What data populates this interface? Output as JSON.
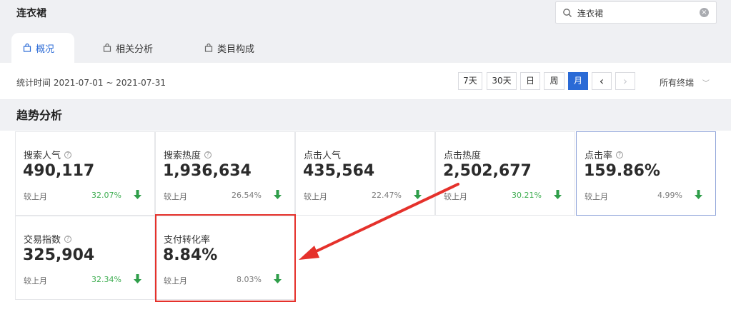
{
  "header": {
    "title": "连衣裙"
  },
  "search": {
    "value": "连衣裙"
  },
  "tabs": [
    {
      "label": "概况",
      "active": true
    },
    {
      "label": "相关分析",
      "active": false
    },
    {
      "label": "类目构成",
      "active": false
    }
  ],
  "filter": {
    "stat_time": "统计时间 2021-07-01 ~ 2021-07-31",
    "periods": [
      "7天",
      "30天",
      "日",
      "周",
      "月"
    ],
    "active_period": "月",
    "prev": "‹",
    "next": "›",
    "terminal": "所有终端"
  },
  "section": {
    "title": "趋势分析"
  },
  "compare_label": "较上月",
  "metrics": [
    {
      "label": "搜索人气",
      "help": true,
      "value": "490,117",
      "change": "32.07%",
      "change_color": "#3fae52",
      "direction": "down"
    },
    {
      "label": "搜索热度",
      "help": true,
      "value": "1,936,634",
      "change": "26.54%",
      "change_color": "#7a7a7a",
      "direction": "down"
    },
    {
      "label": "点击人气",
      "help": false,
      "value": "435,564",
      "change": "22.47%",
      "change_color": "#7a7a7a",
      "direction": "down"
    },
    {
      "label": "点击热度",
      "help": false,
      "value": "2,502,677",
      "change": "30.21%",
      "change_color": "#3fae52",
      "direction": "down"
    },
    {
      "label": "点击率",
      "help": true,
      "value": "159.86%",
      "change": "4.99%",
      "change_color": "#7a7a7a",
      "direction": "down",
      "selected": true
    },
    {
      "label": "交易指数",
      "help": true,
      "value": "325,904",
      "change": "32.34%",
      "change_color": "#3fae52",
      "direction": "down"
    },
    {
      "label": "支付转化率",
      "help": false,
      "value": "8.84%",
      "change": "8.03%",
      "change_color": "#7a7a7a",
      "direction": "down"
    }
  ],
  "colors": {
    "accent": "#2a6ad6",
    "down_arrow": "#2f9e4a",
    "annotation": "#e5312b"
  },
  "icons": {
    "search": "search-icon",
    "clear": "clear-icon",
    "tab": "bag-icon",
    "help": "help-icon",
    "trend": "arrow-down-icon"
  }
}
